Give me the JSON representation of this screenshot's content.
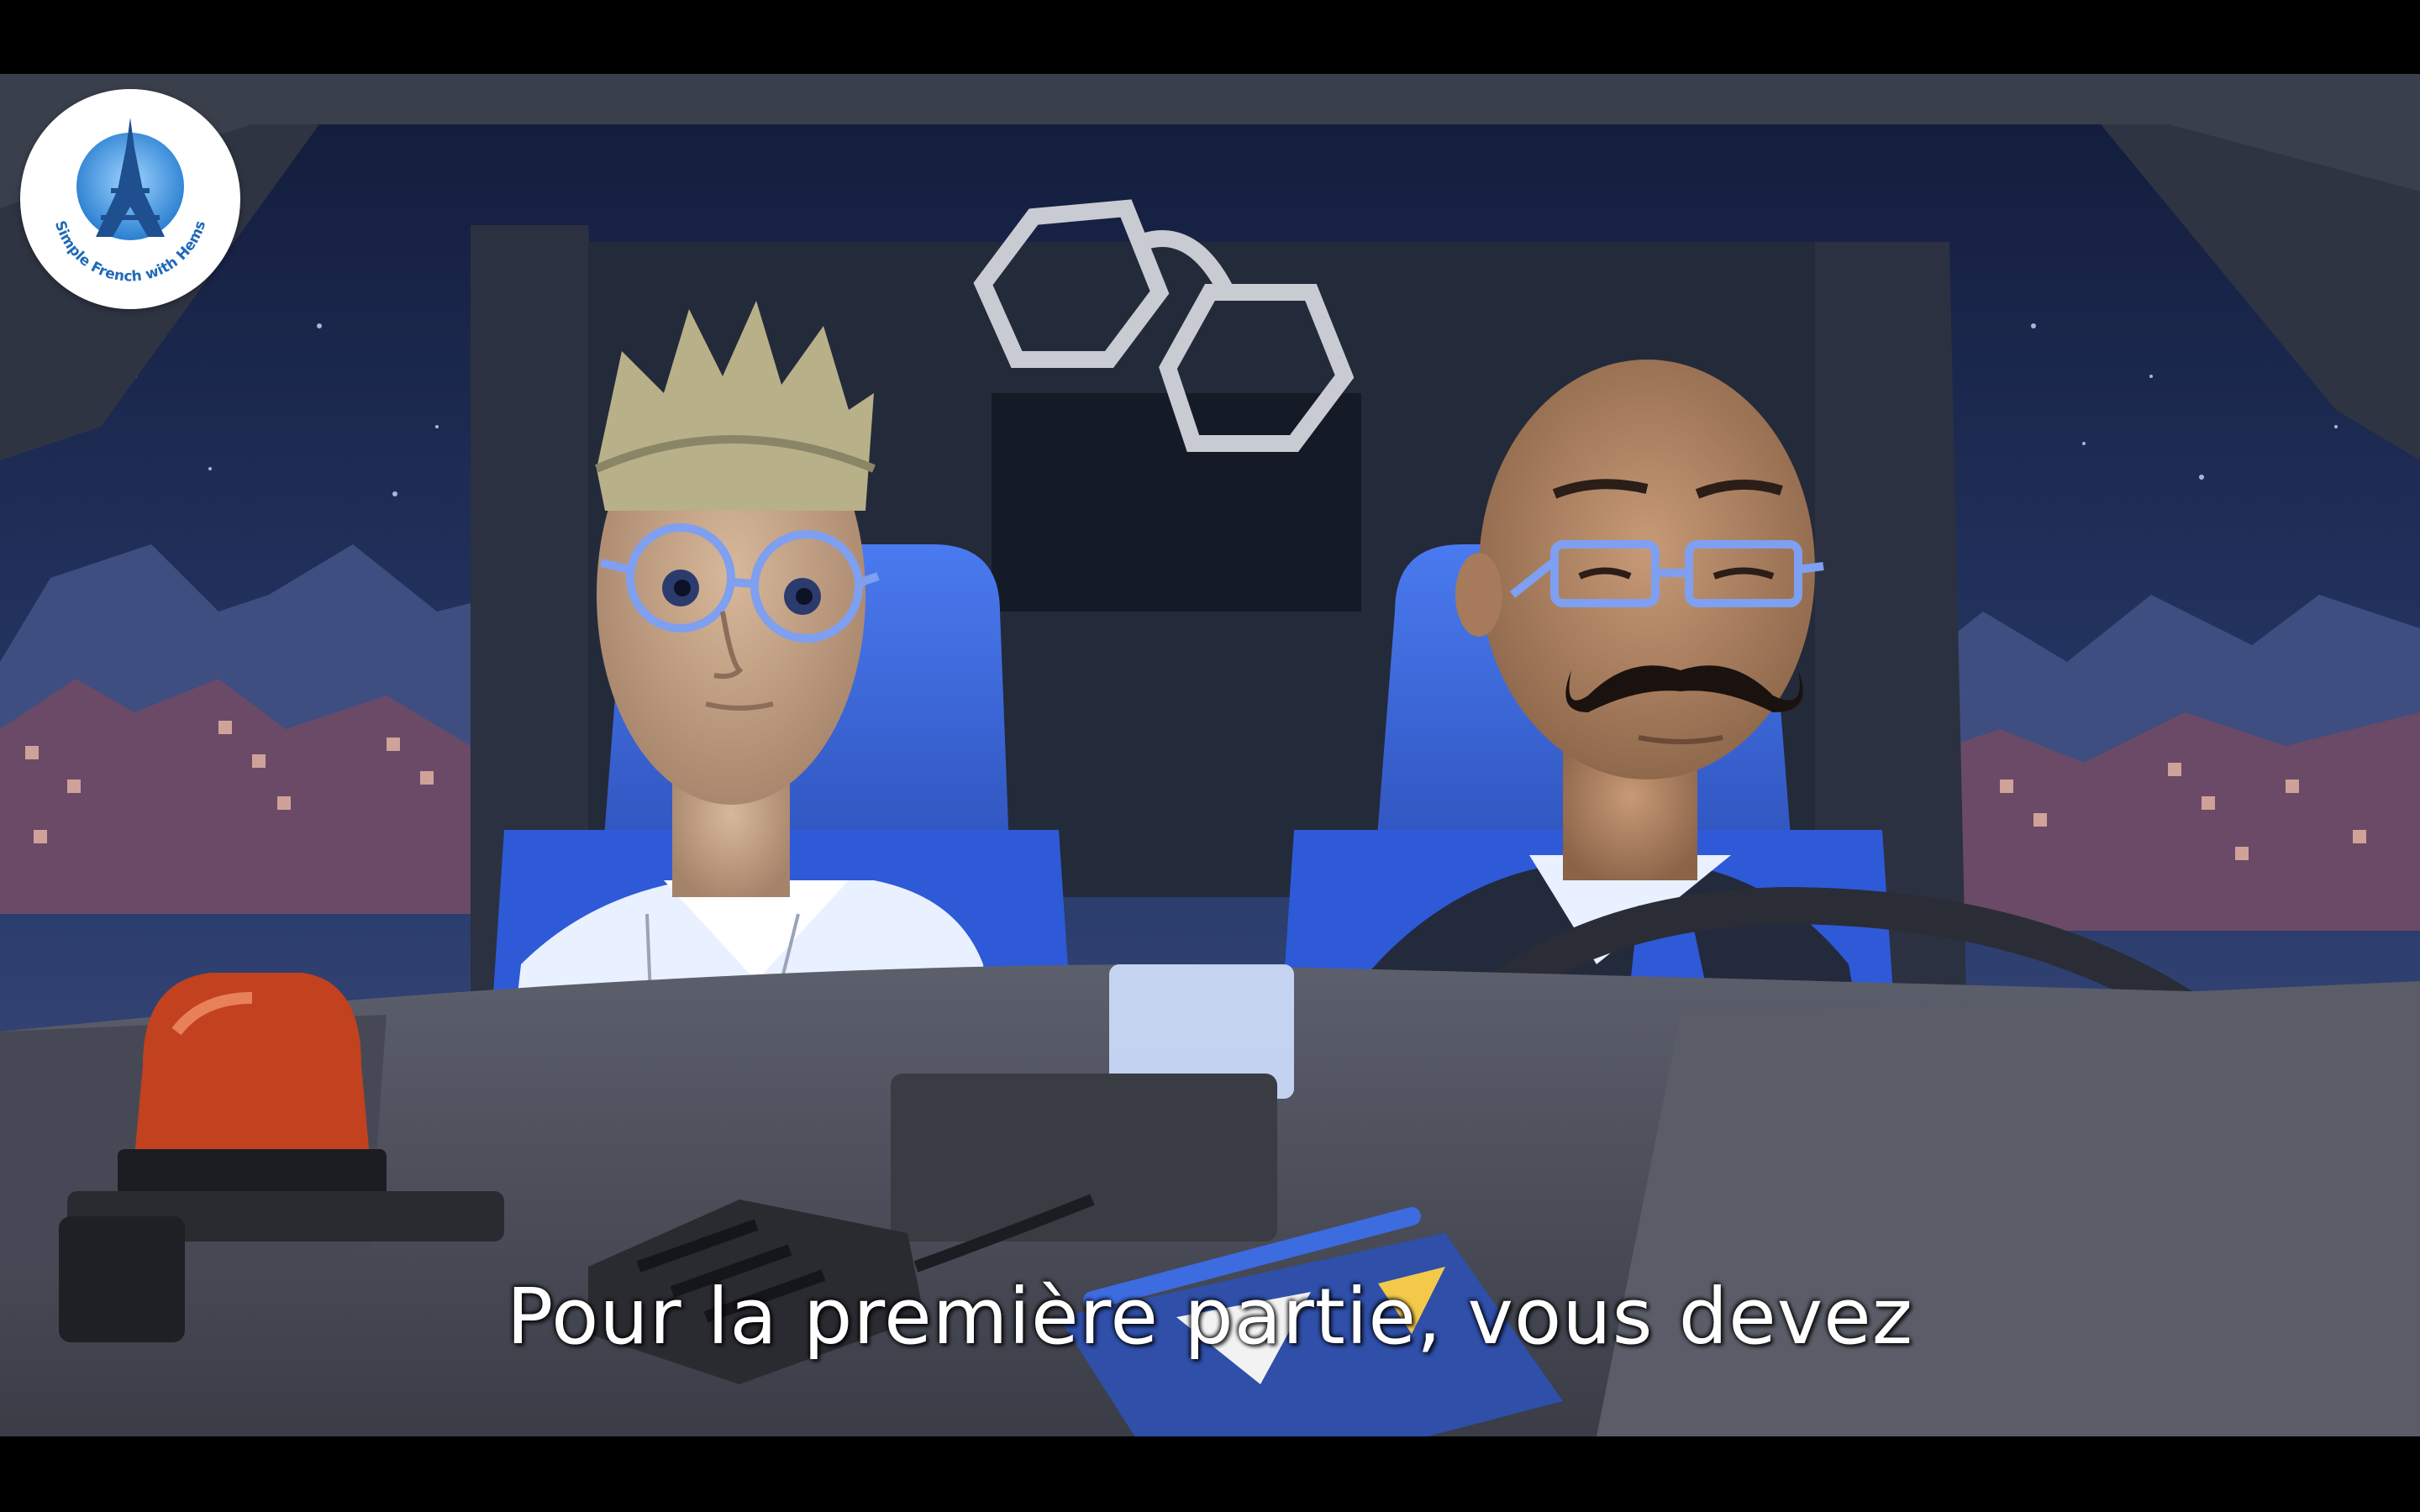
{
  "video": {
    "channel_logo": {
      "text": "Simple French with Hems",
      "icon": "eiffel-tower-icon"
    },
    "subtitle": "Pour la première partie, vous devez",
    "scene_colors": {
      "night_sky": "#1b2748",
      "seat_blue": "#3d6be0",
      "siren_red": "#c2411e",
      "glasses_blue": "#7f9ff0",
      "logo_blue": "#2a7fd1"
    }
  }
}
